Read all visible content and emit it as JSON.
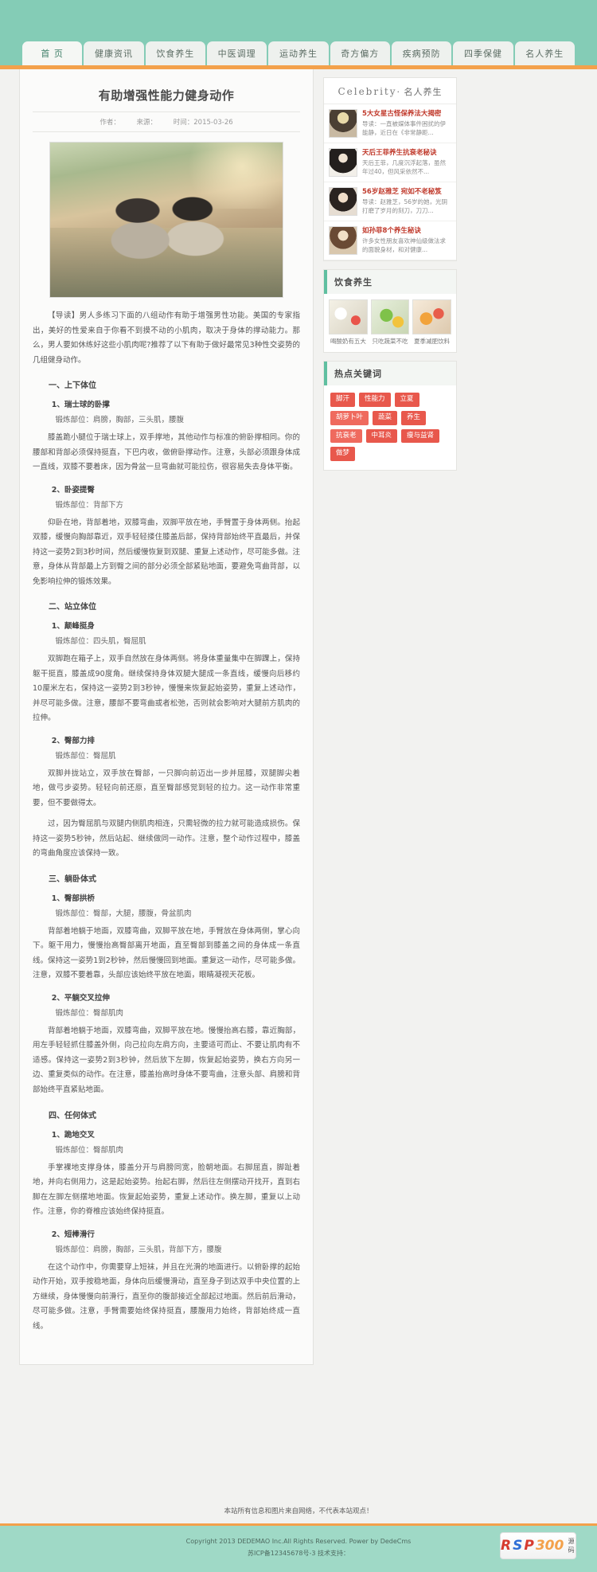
{
  "nav": {
    "items": [
      {
        "label": "首 页",
        "active": true
      },
      {
        "label": "健康资讯",
        "active": false
      },
      {
        "label": "饮食养生",
        "active": false
      },
      {
        "label": "中医调理",
        "active": false
      },
      {
        "label": "运动养生",
        "active": false
      },
      {
        "label": "奇方偏方",
        "active": false
      },
      {
        "label": "疾病预防",
        "active": false
      },
      {
        "label": "四季保健",
        "active": false
      },
      {
        "label": "名人养生",
        "active": false
      }
    ]
  },
  "article": {
    "title": "有助增强性能力健身动作",
    "meta_author": "作者：",
    "meta_source": "来源：",
    "meta_time": "时间：2015-03-26",
    "lead": "【导读】男人多练习下面的八组动作有助于增强男性功能。美国的专家指出，美好的性爱来自于你看不到摸不动的小肌肉，取决于身体的撑动能力。那么，男人要如休练好这些小肌肉呢?推荐了以下有助于做好最常见3种性交姿势的几组健身动作。",
    "sections": [
      {
        "heading": "一、上下体位",
        "items": [
          {
            "sub": "1、瑞士球的卧撑",
            "part": "锻炼部位：肩膀，胸部，三头肌，腰腹",
            "body": "膝盖跪小腿位于瑞士球上，双手撑地，其他动作与标准的俯卧撑相同。你的腰部和背部必须保持挺直，下巴内收，做俯卧撑动作。注意，头部必须跟身体成一直线，双膝不要着床，因为骨盆一旦弯曲就可能拉伤，很容易失去身体平衡。"
          },
          {
            "sub": "2、卧姿提臀",
            "part": "锻炼部位：背部下方",
            "body": "仰卧在地，背部着地，双膝弯曲，双脚平放在地，手臂置于身体两侧。抬起双膝，缓慢向胸部靠近，双手轻轻搂住膝盖后部，保持背部始终平直最后，并保持这一姿势2到3秒时间，然后缓慢恢复到双腿、重复上述动作，尽可能多做。注意，身体从背部最上方到臀之间的部分必须全部紧贴地面，要避免弯曲背部，以免影响拉伸的锻炼效果。"
          }
        ]
      },
      {
        "heading": "二、站立体位",
        "items": [
          {
            "sub": "1、颠峰挺身",
            "part": "锻炼部位：四头肌，臀屈肌",
            "body": "双脚跑在箱子上，双手自然放在身体两侧。将身体重量集中在脚踝上，保持躯干挺直，膝盖成90度角。继续保持身体双腿大腿成一条直线，缓慢向后移约10厘米左右，保持这一姿势2到3秒钟，慢慢来恢复起始姿势，重复上述动作，并尽可能多做。注意，腰部不要弯曲或者松弛，否则就会影响对大腿前方肌肉的拉伸。"
          },
          {
            "sub": "2、臀部力排",
            "part": "锻炼部位：臀屈肌",
            "body": "双脚并拢站立，双手放在臀部，一只脚向前迈出一步并屈膝，双腿脚尖着地，做弓步姿势。轻轻向前还原，直至臀部感觉到轻的拉力。这一动作非常重要，但不要做得太。",
            "extra": "过，因为臀屈肌与双腿内侧肌肉相连，只需轻微的拉力就可能造成损伤。保持这一姿势5秒钟，然后站起、继续做同一动作。注意，整个动作过程中，膝盖的弯曲角度应该保持一致。"
          }
        ]
      },
      {
        "heading": "三、躺卧体式",
        "items": [
          {
            "sub": "1、臀部拱桥",
            "part": "锻炼部位：臀部，大腿，腰腹，骨盆肌肉",
            "body": "背部着地躺于地面，双膝弯曲，双脚平放在地，手臂放在身体两侧，掌心向下。躯干用力，慢慢抬高臀部离开地面，直至臀部到膝盖之间的身体成一条直线。保持这一姿势1到2秒钟，然后慢慢回到地面。重复这一动作，尽可能多做。注意，双膝不要着靠，头部应该始终平放在地面，眼睛凝视天花板。"
          },
          {
            "sub": "2、平躺交叉拉伸",
            "part": "锻炼部位：臀部肌肉",
            "body": "背部着地躺于地面，双膝弯曲，双脚平放在地。慢慢抬高右膝，靠近胸部，用左手轻轻抓住膝盖外侧，向己拉向左肩方向，主要适可而止、不要让肌肉有不适感。保持这一姿势2到3秒钟，然后放下左脚，恢复起始姿势，换右方向另一边、重复类似的动作。在注意，膝盖抬高时身体不要弯曲，注意头部、肩膀和背部始终平直紧贴地面。"
          }
        ]
      },
      {
        "heading": "四、任何体式",
        "items": [
          {
            "sub": "1、跪地交叉",
            "part": "锻炼部位：臀部肌肉",
            "body": "手掌裸地支撑身体，膝盖分开与肩膀同宽，脸朝地面。右脚屈直，脚趾着地，并向右侧用力，这是起始姿势。抬起右脚，然后往左侧摆动开找开，直到右脚在左脚左侧摆地地面。恢复起始姿势，重复上述动作。换左脚，重复以上动作。注意，你的脊椎应该始终保持挺直。"
          },
          {
            "sub": "2、短棒滑行",
            "part": "锻炼部位：肩膀，胸部，三头肌，背部下方，腰腹",
            "body": "在这个动作中，你需要穿上短袜，并且在光滑的地面进行。以俯卧撑的起始动作开始，双手按稳地面，身体向后缓慢滑动，直至身子到达双手中央位置的上方继续，身体慢慢向前滑行，直至你的腹部接近全部起过地面。然后前后滑动，尽可能多做。注意，手臂需要始终保持挺直，腰腹用力始终，背部始终成一直线。"
          }
        ]
      }
    ]
  },
  "sidebar": {
    "celebrity": {
      "title_en": "Celebrity",
      "title_cn": "· 名人养生",
      "items": [
        {
          "title": "5大女星古怪保养法大揭密",
          "desc": "导读：一直被媒体事件困扰的伊能静，近日在《非常静距...",
          "thumb": "celeb-thumb-1"
        },
        {
          "title": "天后王菲养生抗衰老秘诀",
          "desc": "天后王菲，几度沉浮起落，虽然年过40，但风采依然不...",
          "thumb": "celeb-thumb-2"
        },
        {
          "title": "56岁赵雅芝 宛如不老秘笈",
          "desc": "导读：赵雅芝，56岁的她，光阴打磨了岁月的刻刀，刀刀...",
          "thumb": "celeb-thumb-3"
        },
        {
          "title": "如孙菲8个养生秘诀",
          "desc": "许多女性朋友喜欢神仙级做法求的面貌身材，和对健康...",
          "thumb": "celeb-thumb-4"
        }
      ]
    },
    "food": {
      "heading": "饮食养生",
      "items": [
        {
          "caption": "喝酸奶有五大",
          "img": "food-img-1"
        },
        {
          "caption": "只吃蔬菜不吃",
          "img": "food-img-2"
        },
        {
          "caption": "夏季减肥饮料",
          "img": "food-img-3"
        }
      ]
    },
    "hot": {
      "heading": "热点关键词",
      "tags": [
        "脚汗",
        "性能力",
        "立夏",
        "胡萝卜叶",
        "蔬菜",
        "养生",
        "抗衰老",
        "中耳炎",
        "痩与益肾",
        "做梦"
      ]
    }
  },
  "footer": {
    "note": "本站所有信息和图片来自网络，不代表本站观点！",
    "copyright": "Copyright 2013 DEDEMAO Inc.All Rights Reserved. Power by DedeCms",
    "icp": "苏ICP备12345678号-3 技术支持：",
    "badge": {
      "r": "R",
      "s": "S",
      "p": "P",
      "zero": "300",
      "cn": "源码"
    }
  },
  "colors": {
    "brand_green": "#7ecbb4",
    "accent_orange": "#f3a14b",
    "tag_red": "#e8584c",
    "title_red": "#c0392b"
  }
}
